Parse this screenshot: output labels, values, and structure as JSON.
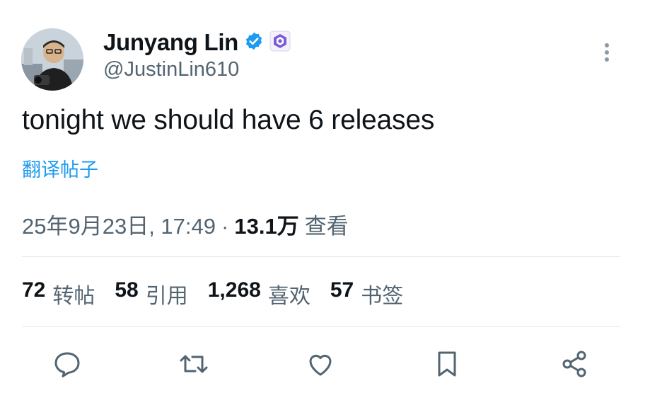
{
  "author": {
    "display_name": "Junyang Lin",
    "handle": "@JustinLin610",
    "verified_badge": "verified-check-icon",
    "affiliate_badge": "org-affiliate-badge-icon"
  },
  "tweet": {
    "text": "tonight we should have 6 releases",
    "translate_label": "翻译帖子"
  },
  "meta": {
    "datetime": "25年9月23日, 17:49",
    "separator": "·",
    "views_count": "13.1万",
    "views_label": "查看"
  },
  "stats": [
    {
      "count": "72",
      "label": "转帖"
    },
    {
      "count": "58",
      "label": "引用"
    },
    {
      "count": "1,268",
      "label": "喜欢"
    },
    {
      "count": "57",
      "label": "书签"
    }
  ],
  "actions": [
    "reply-icon",
    "retweet-icon",
    "like-icon",
    "bookmark-icon",
    "share-icon"
  ],
  "colors": {
    "link": "#1d9bf0",
    "verified": "#1d9bf0",
    "text_primary": "#0f1419",
    "text_secondary": "#536471"
  }
}
